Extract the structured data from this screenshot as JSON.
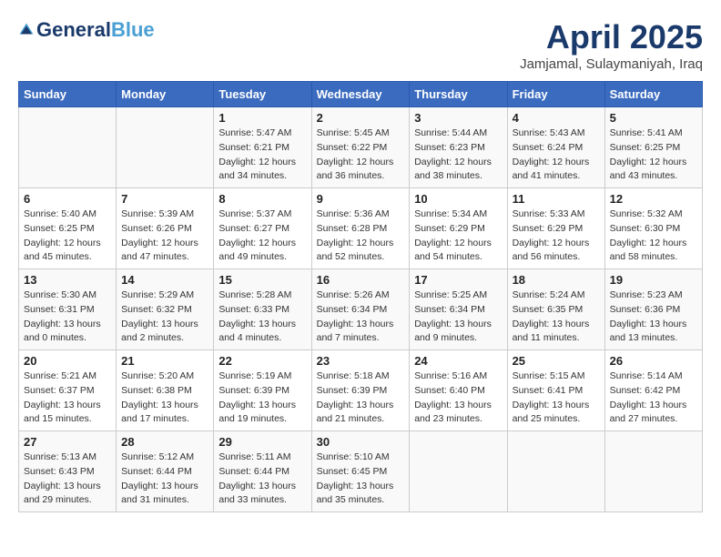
{
  "logo": {
    "general": "General",
    "blue": "Blue",
    "tagline": ""
  },
  "title": "April 2025",
  "subtitle": "Jamjamal, Sulaymaniyah, Iraq",
  "headers": [
    "Sunday",
    "Monday",
    "Tuesday",
    "Wednesday",
    "Thursday",
    "Friday",
    "Saturday"
  ],
  "weeks": [
    [
      {
        "num": "",
        "sunrise": "",
        "sunset": "",
        "daylight": ""
      },
      {
        "num": "",
        "sunrise": "",
        "sunset": "",
        "daylight": ""
      },
      {
        "num": "1",
        "sunrise": "Sunrise: 5:47 AM",
        "sunset": "Sunset: 6:21 PM",
        "daylight": "Daylight: 12 hours and 34 minutes."
      },
      {
        "num": "2",
        "sunrise": "Sunrise: 5:45 AM",
        "sunset": "Sunset: 6:22 PM",
        "daylight": "Daylight: 12 hours and 36 minutes."
      },
      {
        "num": "3",
        "sunrise": "Sunrise: 5:44 AM",
        "sunset": "Sunset: 6:23 PM",
        "daylight": "Daylight: 12 hours and 38 minutes."
      },
      {
        "num": "4",
        "sunrise": "Sunrise: 5:43 AM",
        "sunset": "Sunset: 6:24 PM",
        "daylight": "Daylight: 12 hours and 41 minutes."
      },
      {
        "num": "5",
        "sunrise": "Sunrise: 5:41 AM",
        "sunset": "Sunset: 6:25 PM",
        "daylight": "Daylight: 12 hours and 43 minutes."
      }
    ],
    [
      {
        "num": "6",
        "sunrise": "Sunrise: 5:40 AM",
        "sunset": "Sunset: 6:25 PM",
        "daylight": "Daylight: 12 hours and 45 minutes."
      },
      {
        "num": "7",
        "sunrise": "Sunrise: 5:39 AM",
        "sunset": "Sunset: 6:26 PM",
        "daylight": "Daylight: 12 hours and 47 minutes."
      },
      {
        "num": "8",
        "sunrise": "Sunrise: 5:37 AM",
        "sunset": "Sunset: 6:27 PM",
        "daylight": "Daylight: 12 hours and 49 minutes."
      },
      {
        "num": "9",
        "sunrise": "Sunrise: 5:36 AM",
        "sunset": "Sunset: 6:28 PM",
        "daylight": "Daylight: 12 hours and 52 minutes."
      },
      {
        "num": "10",
        "sunrise": "Sunrise: 5:34 AM",
        "sunset": "Sunset: 6:29 PM",
        "daylight": "Daylight: 12 hours and 54 minutes."
      },
      {
        "num": "11",
        "sunrise": "Sunrise: 5:33 AM",
        "sunset": "Sunset: 6:29 PM",
        "daylight": "Daylight: 12 hours and 56 minutes."
      },
      {
        "num": "12",
        "sunrise": "Sunrise: 5:32 AM",
        "sunset": "Sunset: 6:30 PM",
        "daylight": "Daylight: 12 hours and 58 minutes."
      }
    ],
    [
      {
        "num": "13",
        "sunrise": "Sunrise: 5:30 AM",
        "sunset": "Sunset: 6:31 PM",
        "daylight": "Daylight: 13 hours and 0 minutes."
      },
      {
        "num": "14",
        "sunrise": "Sunrise: 5:29 AM",
        "sunset": "Sunset: 6:32 PM",
        "daylight": "Daylight: 13 hours and 2 minutes."
      },
      {
        "num": "15",
        "sunrise": "Sunrise: 5:28 AM",
        "sunset": "Sunset: 6:33 PM",
        "daylight": "Daylight: 13 hours and 4 minutes."
      },
      {
        "num": "16",
        "sunrise": "Sunrise: 5:26 AM",
        "sunset": "Sunset: 6:34 PM",
        "daylight": "Daylight: 13 hours and 7 minutes."
      },
      {
        "num": "17",
        "sunrise": "Sunrise: 5:25 AM",
        "sunset": "Sunset: 6:34 PM",
        "daylight": "Daylight: 13 hours and 9 minutes."
      },
      {
        "num": "18",
        "sunrise": "Sunrise: 5:24 AM",
        "sunset": "Sunset: 6:35 PM",
        "daylight": "Daylight: 13 hours and 11 minutes."
      },
      {
        "num": "19",
        "sunrise": "Sunrise: 5:23 AM",
        "sunset": "Sunset: 6:36 PM",
        "daylight": "Daylight: 13 hours and 13 minutes."
      }
    ],
    [
      {
        "num": "20",
        "sunrise": "Sunrise: 5:21 AM",
        "sunset": "Sunset: 6:37 PM",
        "daylight": "Daylight: 13 hours and 15 minutes."
      },
      {
        "num": "21",
        "sunrise": "Sunrise: 5:20 AM",
        "sunset": "Sunset: 6:38 PM",
        "daylight": "Daylight: 13 hours and 17 minutes."
      },
      {
        "num": "22",
        "sunrise": "Sunrise: 5:19 AM",
        "sunset": "Sunset: 6:39 PM",
        "daylight": "Daylight: 13 hours and 19 minutes."
      },
      {
        "num": "23",
        "sunrise": "Sunrise: 5:18 AM",
        "sunset": "Sunset: 6:39 PM",
        "daylight": "Daylight: 13 hours and 21 minutes."
      },
      {
        "num": "24",
        "sunrise": "Sunrise: 5:16 AM",
        "sunset": "Sunset: 6:40 PM",
        "daylight": "Daylight: 13 hours and 23 minutes."
      },
      {
        "num": "25",
        "sunrise": "Sunrise: 5:15 AM",
        "sunset": "Sunset: 6:41 PM",
        "daylight": "Daylight: 13 hours and 25 minutes."
      },
      {
        "num": "26",
        "sunrise": "Sunrise: 5:14 AM",
        "sunset": "Sunset: 6:42 PM",
        "daylight": "Daylight: 13 hours and 27 minutes."
      }
    ],
    [
      {
        "num": "27",
        "sunrise": "Sunrise: 5:13 AM",
        "sunset": "Sunset: 6:43 PM",
        "daylight": "Daylight: 13 hours and 29 minutes."
      },
      {
        "num": "28",
        "sunrise": "Sunrise: 5:12 AM",
        "sunset": "Sunset: 6:44 PM",
        "daylight": "Daylight: 13 hours and 31 minutes."
      },
      {
        "num": "29",
        "sunrise": "Sunrise: 5:11 AM",
        "sunset": "Sunset: 6:44 PM",
        "daylight": "Daylight: 13 hours and 33 minutes."
      },
      {
        "num": "30",
        "sunrise": "Sunrise: 5:10 AM",
        "sunset": "Sunset: 6:45 PM",
        "daylight": "Daylight: 13 hours and 35 minutes."
      },
      {
        "num": "",
        "sunrise": "",
        "sunset": "",
        "daylight": ""
      },
      {
        "num": "",
        "sunrise": "",
        "sunset": "",
        "daylight": ""
      },
      {
        "num": "",
        "sunrise": "",
        "sunset": "",
        "daylight": ""
      }
    ]
  ]
}
